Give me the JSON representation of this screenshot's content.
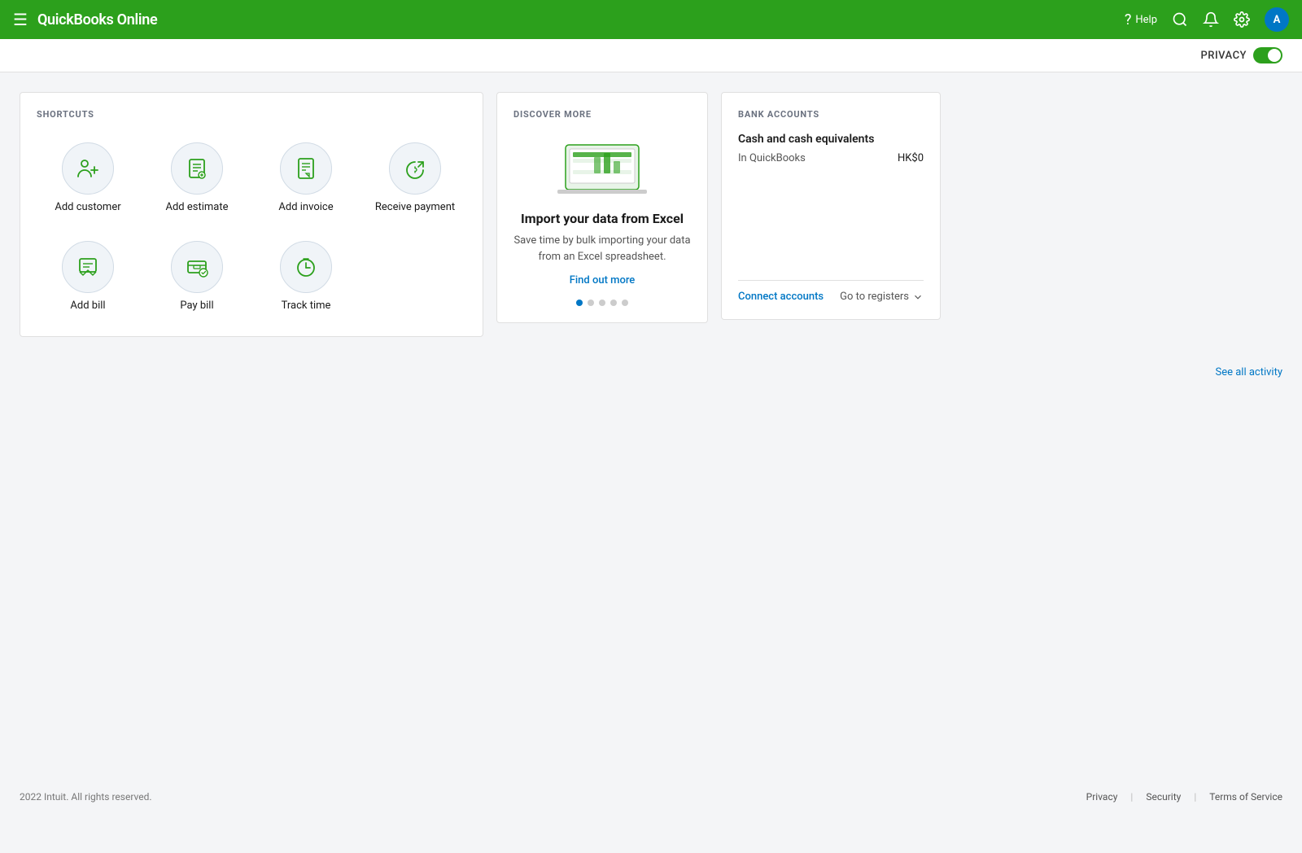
{
  "topnav": {
    "brand": "QuickBooks Online",
    "help_label": "Help",
    "hamburger_icon": "☰"
  },
  "privacy": {
    "label": "PRIVACY",
    "enabled": true
  },
  "shortcuts": {
    "section_title": "SHORTCUTS",
    "row1": [
      {
        "id": "add-customer",
        "label": "Add customer"
      },
      {
        "id": "add-estimate",
        "label": "Add estimate"
      },
      {
        "id": "add-invoice",
        "label": "Add invoice"
      },
      {
        "id": "receive-payment",
        "label": "Receive payment"
      }
    ],
    "row2": [
      {
        "id": "add-bill",
        "label": "Add bill"
      },
      {
        "id": "pay-bill",
        "label": "Pay bill"
      },
      {
        "id": "track-time",
        "label": "Track time"
      }
    ]
  },
  "discover": {
    "section_title": "DISCOVER MORE",
    "heading": "Import your data from Excel",
    "text": "Save time by bulk importing your data from an Excel spreadsheet.",
    "link_label": "Find out more",
    "dots": [
      true,
      false,
      false,
      false,
      false
    ]
  },
  "bank_accounts": {
    "section_title": "BANK ACCOUNTS",
    "section_label": "Cash and cash equivalents",
    "sub_label": "In QuickBooks",
    "amount": "HK$0",
    "connect_label": "Connect accounts",
    "registers_label": "Go to registers"
  },
  "activity": {
    "link_label": "See all activity"
  },
  "footer": {
    "copyright": "2022 Intuit. All rights reserved.",
    "links": [
      "Privacy",
      "Security",
      "Terms of Service"
    ]
  }
}
